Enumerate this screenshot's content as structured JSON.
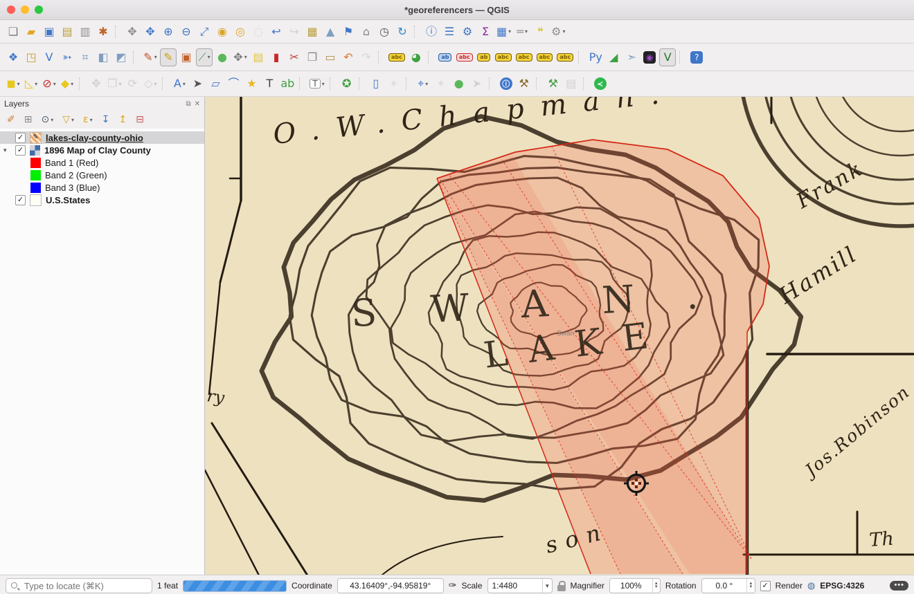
{
  "window": {
    "title": "*georeferencers — QGIS"
  },
  "toolbars": {
    "row1": [
      {
        "n": "new-project",
        "g": "❏",
        "c": "#777777"
      },
      {
        "n": "open-project",
        "g": "▰",
        "c": "#e2a820"
      },
      {
        "n": "save-project",
        "g": "▣",
        "c": "#3f76c8"
      },
      {
        "n": "new-print-layout",
        "g": "▤",
        "c": "#b99f3c"
      },
      {
        "n": "show-layout-manager",
        "g": "▥",
        "c": "#8f8f8f"
      },
      {
        "n": "style-manager",
        "g": "✱",
        "c": "#c0622a"
      },
      {
        "sep": true
      },
      {
        "n": "pan-map",
        "g": "✥",
        "c": "#8a8a8a"
      },
      {
        "n": "pan-to-selection",
        "g": "✥",
        "c": "#3f76c8"
      },
      {
        "n": "zoom-in",
        "g": "⊕",
        "c": "#3f76c8"
      },
      {
        "n": "zoom-out",
        "g": "⊖",
        "c": "#3f76c8"
      },
      {
        "n": "zoom-full-extent",
        "g": "⤢",
        "c": "#3f76c8"
      },
      {
        "n": "zoom-to-selection",
        "g": "◉",
        "c": "#d9a62a"
      },
      {
        "n": "zoom-to-layer",
        "g": "◎",
        "c": "#d9a62a"
      },
      {
        "n": "zoom-native-resolution",
        "g": "◌",
        "c": "#999999",
        "d": true
      },
      {
        "n": "zoom-last",
        "g": "↩",
        "c": "#3f76c8"
      },
      {
        "n": "zoom-next",
        "g": "↪",
        "c": "#999999",
        "d": true
      },
      {
        "n": "new-map-view",
        "g": "▦",
        "c": "#b99f3c"
      },
      {
        "n": "new-3d-map-view",
        "g": "▲",
        "c": "#7f9fc0"
      },
      {
        "n": "new-spatial-bookmark",
        "g": "⚑",
        "c": "#3f76c8"
      },
      {
        "n": "show-bookmarks",
        "g": "⌂",
        "c": "#888888"
      },
      {
        "n": "temporal-controller",
        "g": "◷",
        "c": "#555555"
      },
      {
        "n": "refresh-map",
        "g": "↻",
        "c": "#2f86d0"
      },
      {
        "sep": true
      },
      {
        "n": "identify-features",
        "g": "ⓘ",
        "c": "#3f76c8"
      },
      {
        "n": "statistical-summary",
        "g": "☰",
        "c": "#3f76c8"
      },
      {
        "n": "processing-toolbox",
        "g": "⚙",
        "c": "#3f76c8"
      },
      {
        "n": "sum-line-lengths",
        "g": "Σ",
        "c": "#8a2aa0"
      },
      {
        "n": "open-attribute-table",
        "g": "▦",
        "c": "#3f76c8",
        "dd": true
      },
      {
        "n": "measure-line",
        "g": "═",
        "c": "#999999",
        "dd": true
      },
      {
        "n": "map-tips",
        "g": "❝",
        "c": "#d9c32a"
      },
      {
        "n": "run-feature-action",
        "g": "⚙",
        "c": "#8f8f8f",
        "dd": true
      }
    ],
    "row2": [
      {
        "n": "data-source-manager",
        "g": "❖",
        "c": "#3f76c8"
      },
      {
        "n": "new-geopackage-layer",
        "g": "◳",
        "c": "#c8a030"
      },
      {
        "n": "new-shapefile-layer",
        "g": "V",
        "c": "#3f76c8"
      },
      {
        "n": "new-gpx-layer",
        "g": "➳",
        "c": "#3f76c8"
      },
      {
        "n": "new-temporary-scratch-layer",
        "g": "⌗",
        "c": "#5a84b8"
      },
      {
        "n": "new-virtual-layer",
        "g": "◧",
        "c": "#7f9fc0"
      },
      {
        "n": "new-mesh-layer",
        "g": "◩",
        "c": "#7f9fc0"
      },
      {
        "sep": true
      },
      {
        "n": "current-edits",
        "g": "✎",
        "c": "#c8502a",
        "dd": true
      },
      {
        "n": "toggle-editing",
        "g": "✎",
        "c": "#caa214",
        "p": true
      },
      {
        "n": "save-layer-edits",
        "g": "▣",
        "c": "#c0622a"
      },
      {
        "n": "digitize-with-segment",
        "g": "⟋",
        "c": "#5a9a5a",
        "p": true,
        "dd": true
      },
      {
        "n": "add-polygon-feature",
        "g": "●",
        "c": "#5ab85a"
      },
      {
        "n": "vertex-tool",
        "g": "✥",
        "c": "#777777",
        "dd": true
      },
      {
        "n": "modify-attributes",
        "g": "▤",
        "c": "#e0c43c"
      },
      {
        "n": "delete-selected",
        "g": "▮",
        "c": "#c82a2a"
      },
      {
        "n": "cut-features",
        "g": "✂",
        "c": "#c04040"
      },
      {
        "n": "copy-features",
        "g": "❐",
        "c": "#888888"
      },
      {
        "n": "paste-features",
        "g": "▭",
        "c": "#b09048"
      },
      {
        "n": "undo",
        "g": "↶",
        "c": "#e07830"
      },
      {
        "n": "redo",
        "g": "↷",
        "c": "#aaaaaa",
        "d": true
      },
      {
        "sep": true
      },
      {
        "n": "layer-labeling-options",
        "g": "abc",
        "c": "#7a5c00",
        "tag": "#f2d43c"
      },
      {
        "n": "layer-diagram-options",
        "g": "◕",
        "c": "#3fa03f"
      },
      {
        "sep": true
      },
      {
        "n": "pin-labels",
        "g": "ab",
        "c": "#2a5ca8",
        "tag": "#bcd4f0"
      },
      {
        "n": "highlight-pinned-labels",
        "g": "abc",
        "c": "#c82a2a",
        "tag": "#f8d8d8"
      },
      {
        "n": "show-hide-labels",
        "g": "ab",
        "c": "#7a5c00",
        "tag": "#f2d43c"
      },
      {
        "n": "show-unplaced-labels",
        "g": "abc",
        "c": "#7a5c00",
        "tag": "#f2d43c"
      },
      {
        "n": "move-label",
        "g": "abc",
        "c": "#7a5c00",
        "tag": "#f2d43c"
      },
      {
        "n": "rotate-label",
        "g": "abc",
        "c": "#7a5c00",
        "tag": "#f2d43c"
      },
      {
        "n": "change-label",
        "g": "abc",
        "c": "#7a5c00",
        "tag": "#f2d43c"
      },
      {
        "sep": true
      },
      {
        "n": "python-console",
        "g": "Py",
        "c": "#3f76c8"
      },
      {
        "n": "profile-tool",
        "g": "◢",
        "c": "#3fa03f"
      },
      {
        "n": "georeferencer-plugin",
        "g": "➣",
        "c": "#7f9fc0"
      },
      {
        "n": "grass-tools",
        "g": "◉",
        "c": "#9a4ac8",
        "bg": "#222222"
      },
      {
        "n": "digitizing-tools",
        "g": "V",
        "c": "#2a7a2a",
        "p": true
      },
      {
        "sep": true
      },
      {
        "n": "help-contents",
        "g": "?",
        "c": "#ffffff",
        "bg": "#3f76c8"
      }
    ],
    "row3": [
      {
        "n": "select-features",
        "g": "◼",
        "c": "#e8c820",
        "dd": true
      },
      {
        "n": "select-features-by-value",
        "g": "◺",
        "c": "#e8c820",
        "dd": true
      },
      {
        "n": "deselect-features",
        "g": "⊘",
        "c": "#c82a2a",
        "dd": true
      },
      {
        "n": "select-by-location",
        "g": "◆",
        "c": "#e8c820",
        "dd": true
      },
      {
        "sep": true
      },
      {
        "n": "move-features",
        "g": "✥",
        "c": "#999999",
        "d": true
      },
      {
        "n": "copy-move-features",
        "g": "❐",
        "c": "#999999",
        "d": true,
        "dd": true
      },
      {
        "n": "rotate-symbols",
        "g": "⟳",
        "c": "#999999",
        "d": true
      },
      {
        "n": "reshape-features",
        "g": "◇",
        "c": "#999999",
        "d": true,
        "dd": true
      },
      {
        "sep": true
      },
      {
        "n": "annotation-settings",
        "g": "A",
        "c": "#3f76c8",
        "dd": true
      },
      {
        "n": "select-annotation",
        "g": "➤",
        "c": "#555555"
      },
      {
        "n": "create-polygon-annotation",
        "g": "▱",
        "c": "#3f76c8"
      },
      {
        "n": "create-line-annotation",
        "g": "⌒",
        "c": "#3f76c8"
      },
      {
        "n": "create-marker-annotation",
        "g": "★",
        "c": "#e8b820"
      },
      {
        "n": "create-text-annotation",
        "g": "T",
        "c": "#444444"
      },
      {
        "n": "create-html-annotation",
        "g": "ab",
        "c": "#3fa03f"
      },
      {
        "sep": true
      },
      {
        "n": "form-annotation",
        "g": "T",
        "c": "#555555",
        "box": true,
        "dd": true
      },
      {
        "sep": true
      },
      {
        "n": "metasearch",
        "g": "✪",
        "c": "#3fa03f"
      },
      {
        "sep": true
      },
      {
        "n": "gps-information",
        "g": "▯",
        "c": "#3f76c8"
      },
      {
        "n": "gps-center",
        "g": "⌖",
        "c": "#999999",
        "d": true
      },
      {
        "sep": true
      },
      {
        "n": "move-canvas-center",
        "g": "⌖",
        "c": "#3f76c8",
        "dd": true
      },
      {
        "n": "gps-add-point",
        "g": "⌖",
        "c": "#999999",
        "d": true
      },
      {
        "n": "add-lake-feature",
        "g": "●",
        "c": "#5ab85a"
      },
      {
        "n": "stream-digitizing",
        "g": "➤",
        "c": "#999999",
        "d": true
      },
      {
        "sep": true
      },
      {
        "n": "plugin-information",
        "g": "ⓘ",
        "c": "#ffffff",
        "bg": "#3f76c8",
        "round": true
      },
      {
        "n": "map-tools-pencil",
        "g": "⚒",
        "c": "#8a6a2a"
      },
      {
        "sep": true
      },
      {
        "n": "freehand-digitizing",
        "g": "⚒",
        "c": "#3fa03f"
      },
      {
        "n": "print-composer",
        "g": "▤",
        "c": "#999999",
        "d": true
      },
      {
        "sep": true
      },
      {
        "n": "share",
        "g": "≺",
        "c": "#ffffff",
        "bg": "#2fb84f",
        "round": true
      }
    ]
  },
  "layers_panel": {
    "title": "Layers",
    "float_button": "⧉",
    "close_button": "✕",
    "tools": [
      {
        "n": "open-layer-styling",
        "g": "✐",
        "c": "#c87a2a"
      },
      {
        "n": "add-group",
        "g": "⊞",
        "c": "#888888"
      },
      {
        "n": "manage-map-themes",
        "g": "⊙",
        "c": "#4a5a6a",
        "dd": true
      },
      {
        "n": "filter-legend",
        "g": "▽",
        "c": "#d9a520",
        "dd": true
      },
      {
        "n": "filter-by-expression",
        "g": "ε",
        "c": "#d9a520",
        "dd": true
      },
      {
        "n": "expand-all",
        "g": "↧",
        "c": "#3f76c8"
      },
      {
        "n": "collapse-all",
        "g": "↥",
        "c": "#d9a520"
      },
      {
        "n": "remove-layer",
        "g": "⊟",
        "c": "#c85a5a"
      }
    ],
    "items": [
      {
        "label": "lakes-clay-county-ohio",
        "checked": true,
        "selected": true,
        "bold": true,
        "underline": true,
        "icon": "edit-layer",
        "indent": 1
      },
      {
        "label": "1896 Map of Clay County",
        "checked": true,
        "bold": true,
        "icon": "raster",
        "indent": 1,
        "expander": "▾"
      },
      {
        "label": "Band 1 (Red)",
        "swatch": "#ff0000",
        "indent": 2
      },
      {
        "label": "Band 2 (Green)",
        "swatch": "#00ee00",
        "indent": 2
      },
      {
        "label": "Band 3 (Blue)",
        "swatch": "#0000ff",
        "indent": 2
      },
      {
        "label": "U.S.States",
        "checked": true,
        "bold": true,
        "swatch": "#fdfdf4",
        "border": true,
        "indent": 1
      }
    ]
  },
  "map": {
    "labels": {
      "chapman": "O.W.Chapman.",
      "swan": "SWAN.",
      "lake": "LAKE",
      "swan_small": "Swan",
      "frank": "Frank",
      "hamill": "Hamill",
      "robinson": "Jos.Robinson",
      "th": "Th",
      "ry": "ry",
      "son": "son"
    },
    "paper_color": "#eee1bf",
    "ink_color": "#2f2417",
    "overlay_color": "#f25540",
    "outline_color": "#d42818"
  },
  "status_bar": {
    "locator_placeholder": "Type to locate (⌘K)",
    "features_count": "1 feat",
    "coordinate_label": "Coordinate",
    "coordinate_value": "43.16409°,-94.95819°",
    "scale_label": "Scale",
    "scale_value": "1:4480",
    "magnifier_label": "Magnifier",
    "magnifier_value": "100%",
    "rotation_label": "Rotation",
    "rotation_value": "0.0 °",
    "render_label": "Render",
    "crs": "EPSG:4326",
    "messages_icon": "•••"
  }
}
